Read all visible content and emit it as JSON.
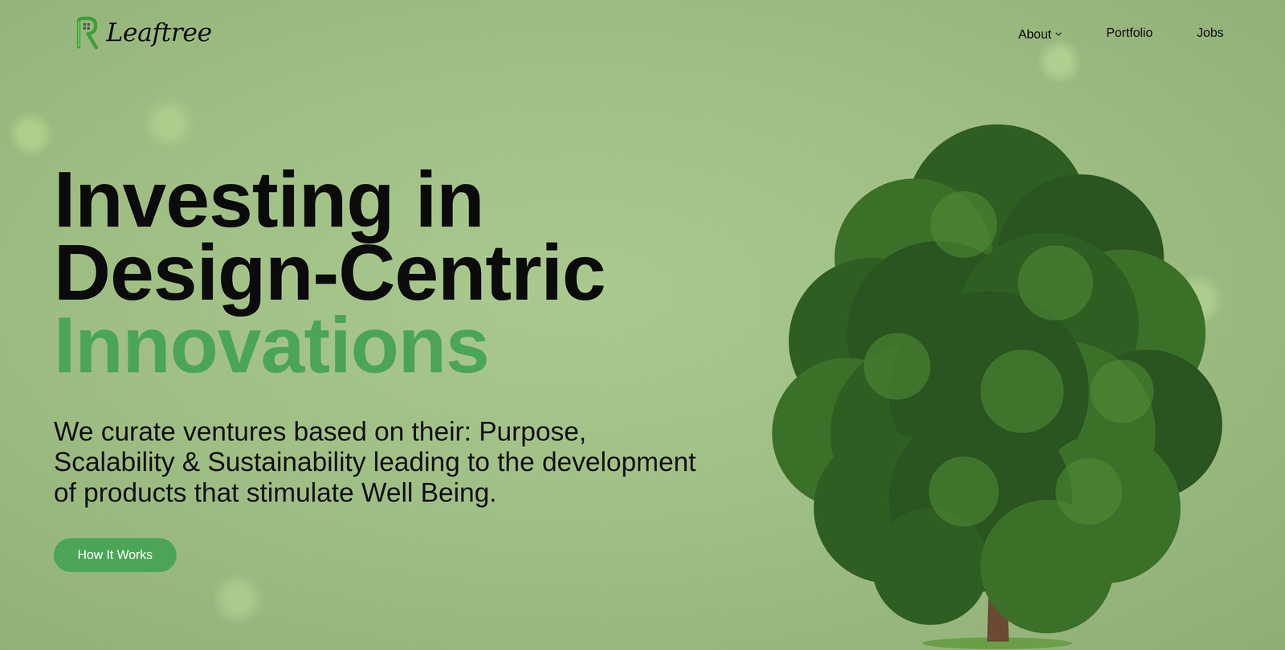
{
  "logo": {
    "text": "Leaftree"
  },
  "nav": [
    {
      "label": "About",
      "kind": "dropdown"
    },
    {
      "label": "Portfolio",
      "kind": "link"
    },
    {
      "label": "Jobs",
      "kind": "link"
    }
  ],
  "hero": {
    "title_lines": [
      "Investing in",
      "Design-Centric"
    ],
    "title_accent": "Innovations",
    "description": "We curate ventures based on their: Purpose, Scalability & Sustainability leading to the development of products that stimulate Well Being.",
    "button": "How It Works"
  }
}
